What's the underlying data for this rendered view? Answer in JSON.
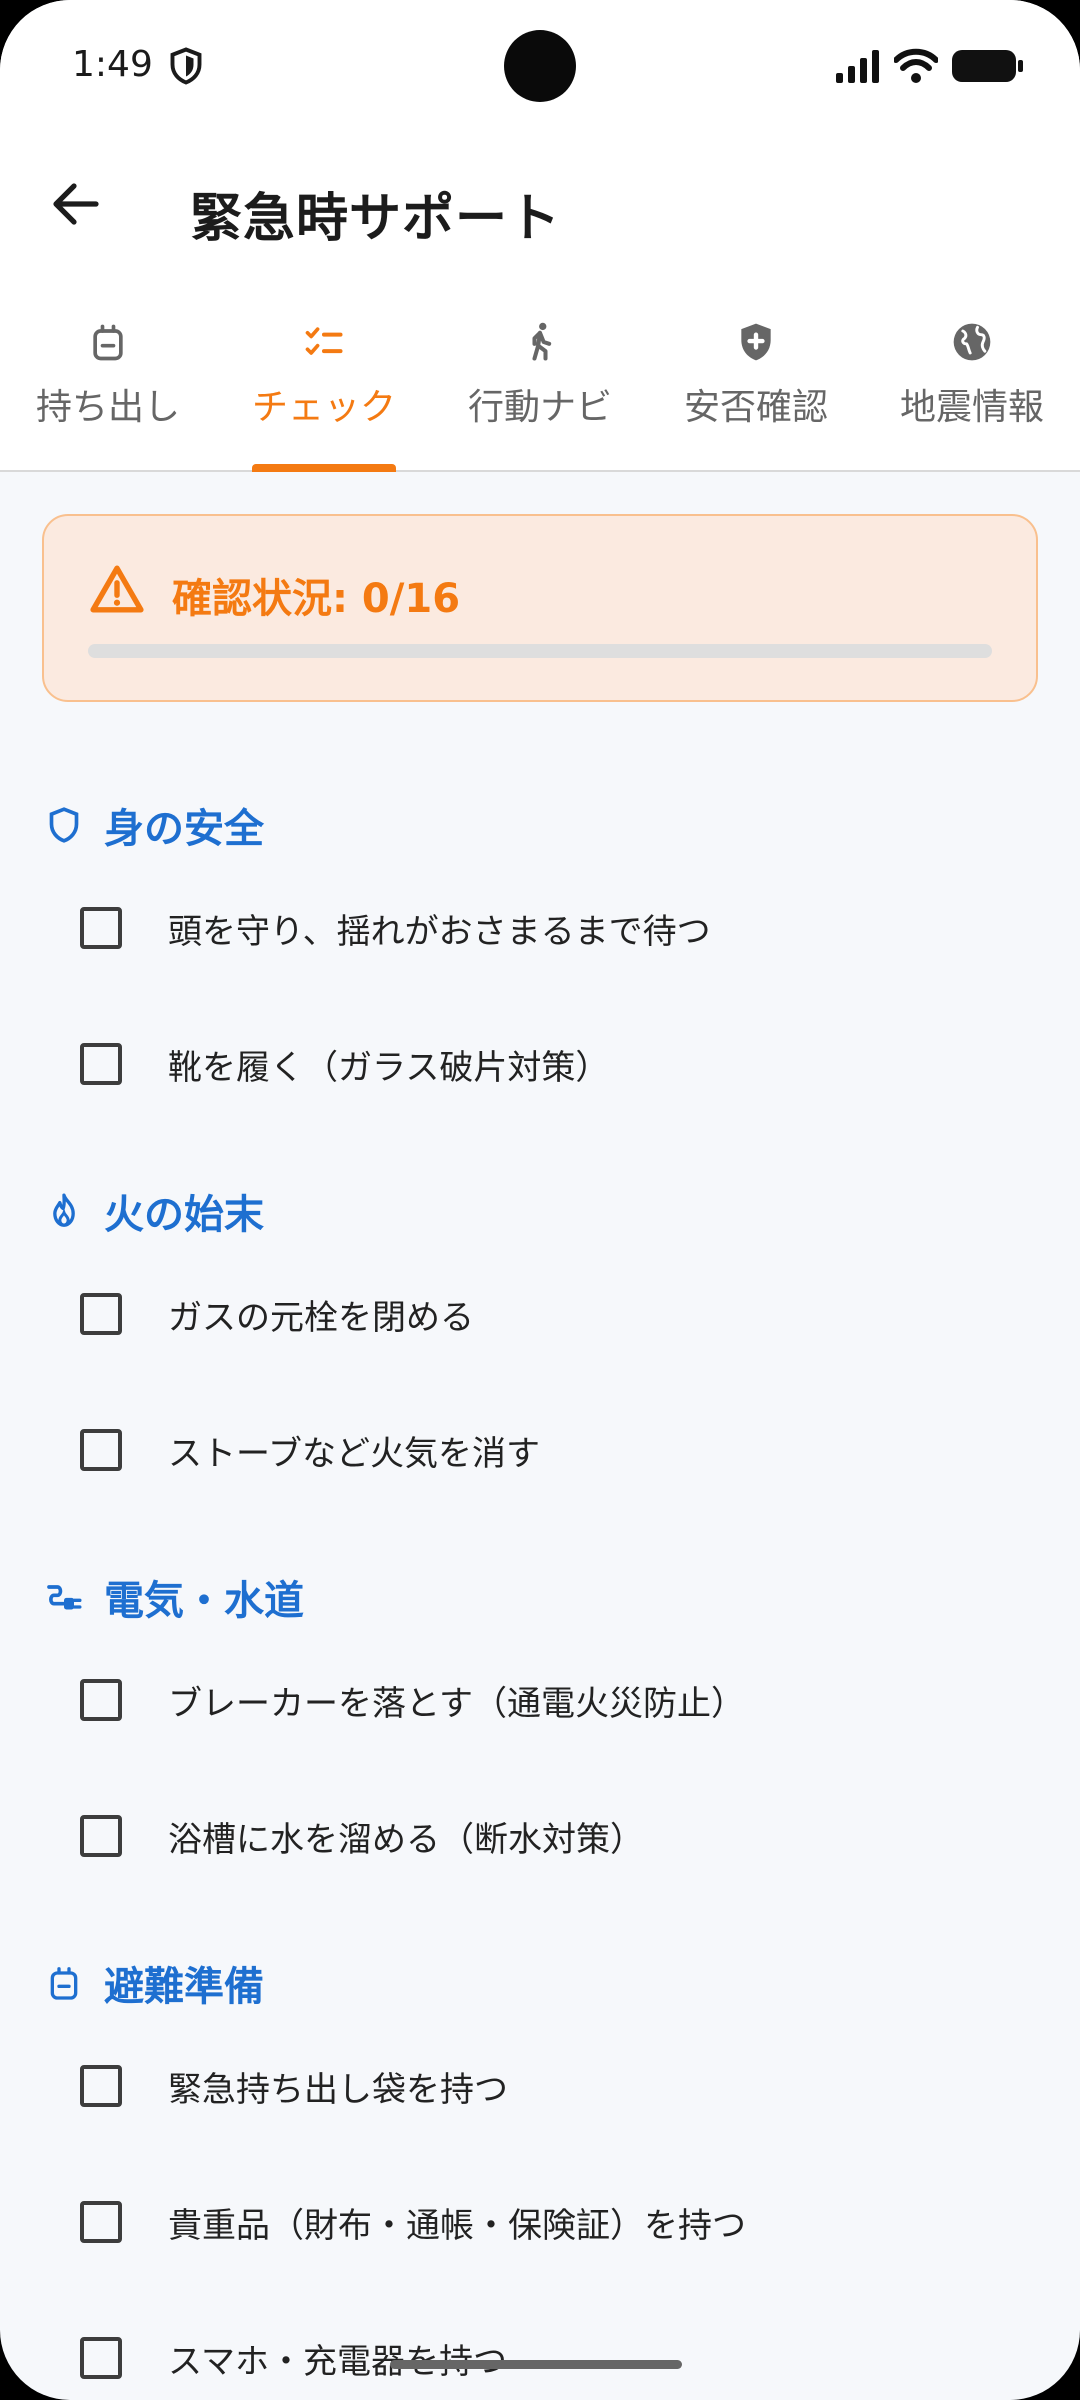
{
  "status_bar": {
    "time": "1:49"
  },
  "header": {
    "title": "緊急時サポート"
  },
  "tabs": [
    {
      "label": "持ち出し",
      "icon": "bag-icon"
    },
    {
      "label": "チェック",
      "icon": "checklist-icon",
      "active": true
    },
    {
      "label": "行動ナビ",
      "icon": "walk-icon"
    },
    {
      "label": "安否確認",
      "icon": "health-shield-icon"
    },
    {
      "label": "地震情報",
      "icon": "globe-icon"
    }
  ],
  "status_card": {
    "text": "確認状況: 0/16",
    "progress": 0
  },
  "sections": [
    {
      "title": "身の安全",
      "icon": "shield-icon",
      "items": [
        "頭を守り、揺れがおさまるまで待つ",
        "靴を履く（ガラス破片対策）"
      ]
    },
    {
      "title": "火の始末",
      "icon": "flame-icon",
      "items": [
        "ガスの元栓を閉める",
        "ストーブなど火気を消す"
      ]
    },
    {
      "title": "電気・水道",
      "icon": "plug-icon",
      "items": [
        "ブレーカーを落とす（通電火災防止）",
        "浴槽に水を溜める（断水対策）"
      ]
    },
    {
      "title": "避難準備",
      "icon": "bag-icon",
      "items": [
        "緊急持ち出し袋を持つ",
        "貴重品（財布・通帳・保険証）を持つ",
        "スマホ・充電器を持つ"
      ]
    }
  ],
  "colors": {
    "accent": "#f47a12",
    "section": "#1e6fd0",
    "card_bg": "#fbeae0",
    "card_border": "#f9c08e"
  }
}
